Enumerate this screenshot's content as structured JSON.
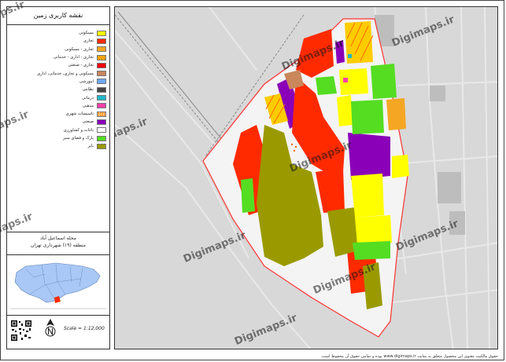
{
  "legend": {
    "title": "نقشه کاربری زمین",
    "items": [
      {
        "label": "مسکونی",
        "color": "#ffff00",
        "pattern": "solid"
      },
      {
        "label": "تجاری",
        "color": "#ff2a00",
        "pattern": "solid"
      },
      {
        "label": "تجاری - مسکونی",
        "color": "#f5a623",
        "pattern": "solid"
      },
      {
        "label": "تجاری - اداری - خدماتی",
        "color": "#ffcc00",
        "pattern": "hatch"
      },
      {
        "label": "تجاری - صنعتی",
        "color": "#ff0000",
        "pattern": "solid"
      },
      {
        "label": "مسکونی و تجاری، خدماتی، اداری",
        "color": "#c9875a",
        "pattern": "solid"
      },
      {
        "label": "آموزشی",
        "color": "#6fa8ff",
        "pattern": "solid"
      },
      {
        "label": "نظامی",
        "color": "#444444",
        "pattern": "solid"
      },
      {
        "label": "درمانی",
        "color": "#1fb8c9",
        "pattern": "solid"
      },
      {
        "label": "مذهبی",
        "color": "#ff3fa8",
        "pattern": "solid"
      },
      {
        "label": "تاسیسات شهری",
        "color": "#ff6a00",
        "pattern": "dots"
      },
      {
        "label": "صنعتی",
        "color": "#8a00b8",
        "pattern": "solid"
      },
      {
        "label": "باغات و کشاورزی",
        "color": "#ffffff",
        "pattern": "solid"
      },
      {
        "label": "پارک و فضای سبز",
        "color": "#55dd22",
        "pattern": "solid"
      },
      {
        "label": "بایر",
        "color": "#9a9a00",
        "pattern": "solid"
      }
    ]
  },
  "area": {
    "line1": "محله اسماعیل آباد",
    "line2": "منطقه (۱۹) شهرداری تهران"
  },
  "scale_label": "Scale = 1:12,000",
  "footer_text": "حقوق مالکیت معنوی این محصول متعلق به سایت www.digimaps.ir بوده و تمامی حقوق آن محفوظ است.",
  "watermark": "Digimaps.ir",
  "colors": {
    "residential": "#ffff00",
    "commercial": "#ff2a00",
    "industrial": "#8a00b8",
    "park": "#55dd22",
    "barren": "#9a9a00",
    "boundary": "#ff3030",
    "background": "#d8d8d8"
  }
}
